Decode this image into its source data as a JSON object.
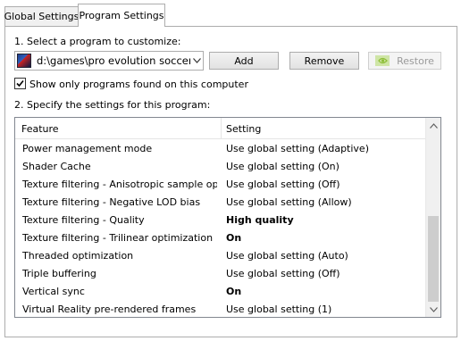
{
  "tabs": [
    {
      "label": "Global Settings"
    },
    {
      "label": "Program Settings"
    }
  ],
  "step1": {
    "label": "1. Select a program to customize:",
    "program_value": "d:\\games\\pro evolution soccer ...",
    "add_label": "Add",
    "remove_label": "Remove",
    "restore_label": "Restore"
  },
  "checkbox": {
    "label": "Show only programs found on this computer",
    "checked": true
  },
  "step2": {
    "label": "2. Specify the settings for this program:"
  },
  "table": {
    "headers": {
      "feature": "Feature",
      "setting": "Setting"
    },
    "rows": [
      {
        "feature": "Power management mode",
        "setting": "Use global setting (Adaptive)"
      },
      {
        "feature": "Shader Cache",
        "setting": "Use global setting (On)"
      },
      {
        "feature": "Texture filtering - Anisotropic sample opti...",
        "setting": "Use global setting (Off)"
      },
      {
        "feature": "Texture filtering - Negative LOD bias",
        "setting": "Use global setting (Allow)"
      },
      {
        "feature": "Texture filtering - Quality",
        "setting": "High quality"
      },
      {
        "feature": "Texture filtering - Trilinear optimization",
        "setting": "On"
      },
      {
        "feature": "Threaded optimization",
        "setting": "Use global setting (Auto)"
      },
      {
        "feature": "Triple buffering",
        "setting": "Use global setting (Off)"
      },
      {
        "feature": "Vertical sync",
        "setting": "On"
      },
      {
        "feature": "Virtual Reality pre-rendered frames",
        "setting": "Use global setting (1)"
      }
    ]
  },
  "icons": {
    "program_icon": "game-icon",
    "restore_icon": "nvidia-logo-icon",
    "dropdown": "chevron-down-icon"
  },
  "colors": {
    "nvidia_green": "#76b900"
  }
}
